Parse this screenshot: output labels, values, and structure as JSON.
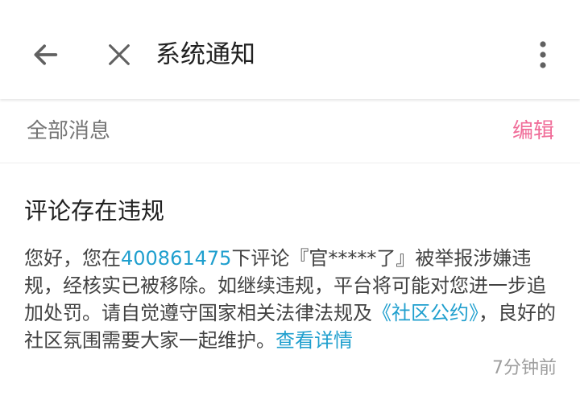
{
  "topbar": {
    "back_icon": "arrow-left-icon",
    "close_icon": "close-icon",
    "title": "系统通知",
    "more_icon": "more-vertical-icon"
  },
  "filter": {
    "label": "全部消息",
    "edit_label": "编辑"
  },
  "message": {
    "title": "评论存在违规",
    "body_1": "您好，您在",
    "video_id": "400861475",
    "body_2": "下评论『官*****了』被举报涉嫌违规，经核实已被移除。如继续违规，平台将可能对您进一步追加处罚。请自觉遵守国家相关法律法规及",
    "rules_link": "《社区公约》",
    "body_3": "，良好的社区氛围需要大家一起维护。",
    "detail_link": "查看详情",
    "time": "7分钟前"
  },
  "colors": {
    "accent": "#f06d99",
    "link": "#1f9fce",
    "title_text": "#212121",
    "body_text": "#424242",
    "muted_text": "#757575",
    "time_text": "#9e9e9e"
  }
}
